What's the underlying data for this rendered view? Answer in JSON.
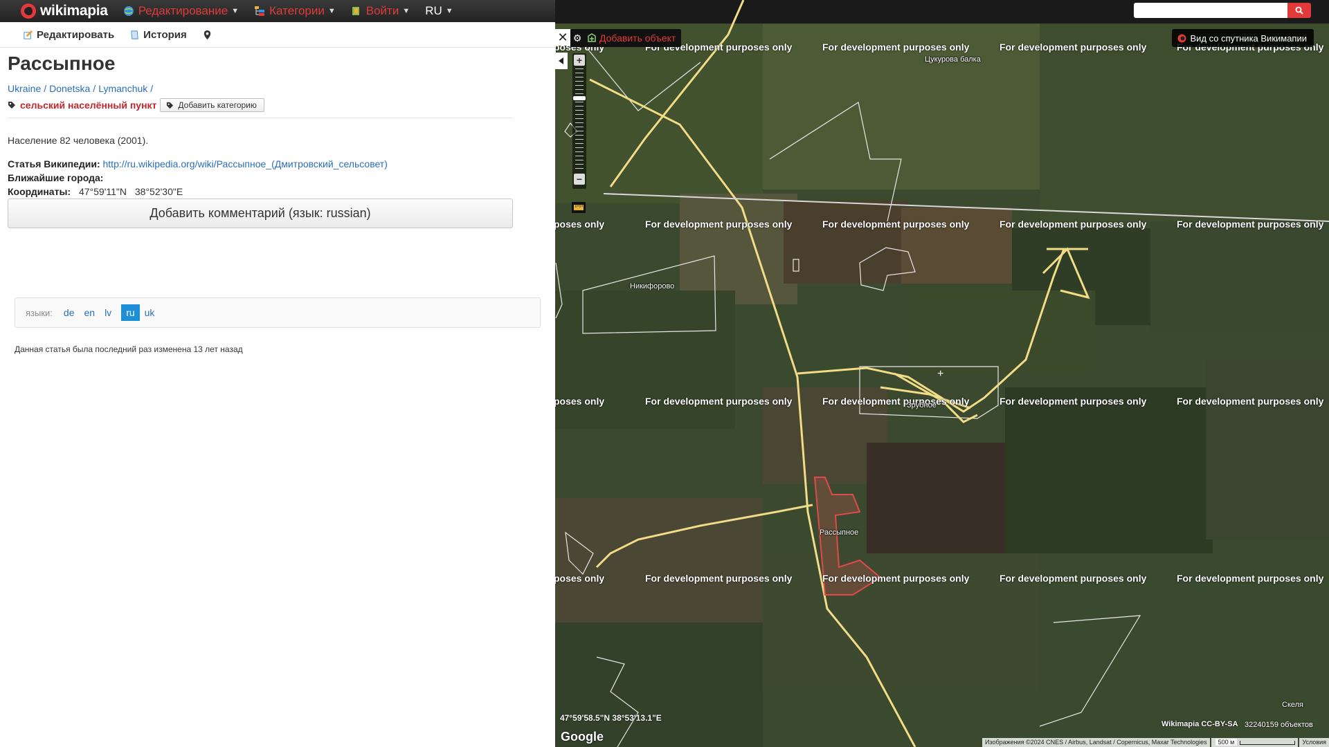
{
  "topbar": {
    "logo": "wikimapia",
    "edit": "Редактирование",
    "categories": "Категории",
    "login": "Войти",
    "lang": "RU"
  },
  "toolbar": {
    "edit": "Редактировать",
    "history": "История"
  },
  "article": {
    "title": "Рассыпное",
    "breadcrumb": [
      "Ukraine",
      "Donetska",
      "Lymanchuk"
    ],
    "category": "сельский населённый пункт",
    "add_category": "Добавить категорию",
    "population": "Население 82 человека (2001).",
    "wiki_label": "Статья Википедии:",
    "wiki_link": "http://ru.wikipedia.org/wiki/Рассыпное_(Дмитровский_сельсовет)",
    "nearby_label": "Ближайшие города:",
    "coords_label": "Координаты:",
    "coords_lat": "47°59'11\"N",
    "coords_lon": "38°52'30\"E",
    "comment_button": "Добавить комментарий (язык: russian)"
  },
  "languages": {
    "label": "языки:",
    "items": [
      "de",
      "en",
      "lv",
      "ru",
      "uk"
    ],
    "active": "ru"
  },
  "modified": "Данная статья была последний раз изменена 13 лет назад",
  "map": {
    "add_object": "Добавить объект",
    "satellite_view": "Вид со спутника Викимапии",
    "watermark": "For development purposes only",
    "watermark_edge": "poses only",
    "places": {
      "tsukurova": "Цукурова балка",
      "nikiforovo": "Никифорово",
      "zrubnoe": "Зрубное",
      "rassypnoe": "Рассыпное",
      "skelya": "Скеля"
    },
    "cursor_coords": "47°59'58.5\"N 38°53'13.1\"E",
    "google": "Google",
    "license": "Wikimapia CC-BY-SA",
    "object_count": "32240159 объектов",
    "imagery": "Изображения ©2024 CNES / Airbus, Landsat / Copernicus, Maxar Technologies",
    "scale": "500 м",
    "terms": "Условия"
  },
  "colors": {
    "accent": "#e03a3a",
    "link": "#2a6ebb",
    "category": "#c0282d",
    "road": "#f2dc86"
  }
}
